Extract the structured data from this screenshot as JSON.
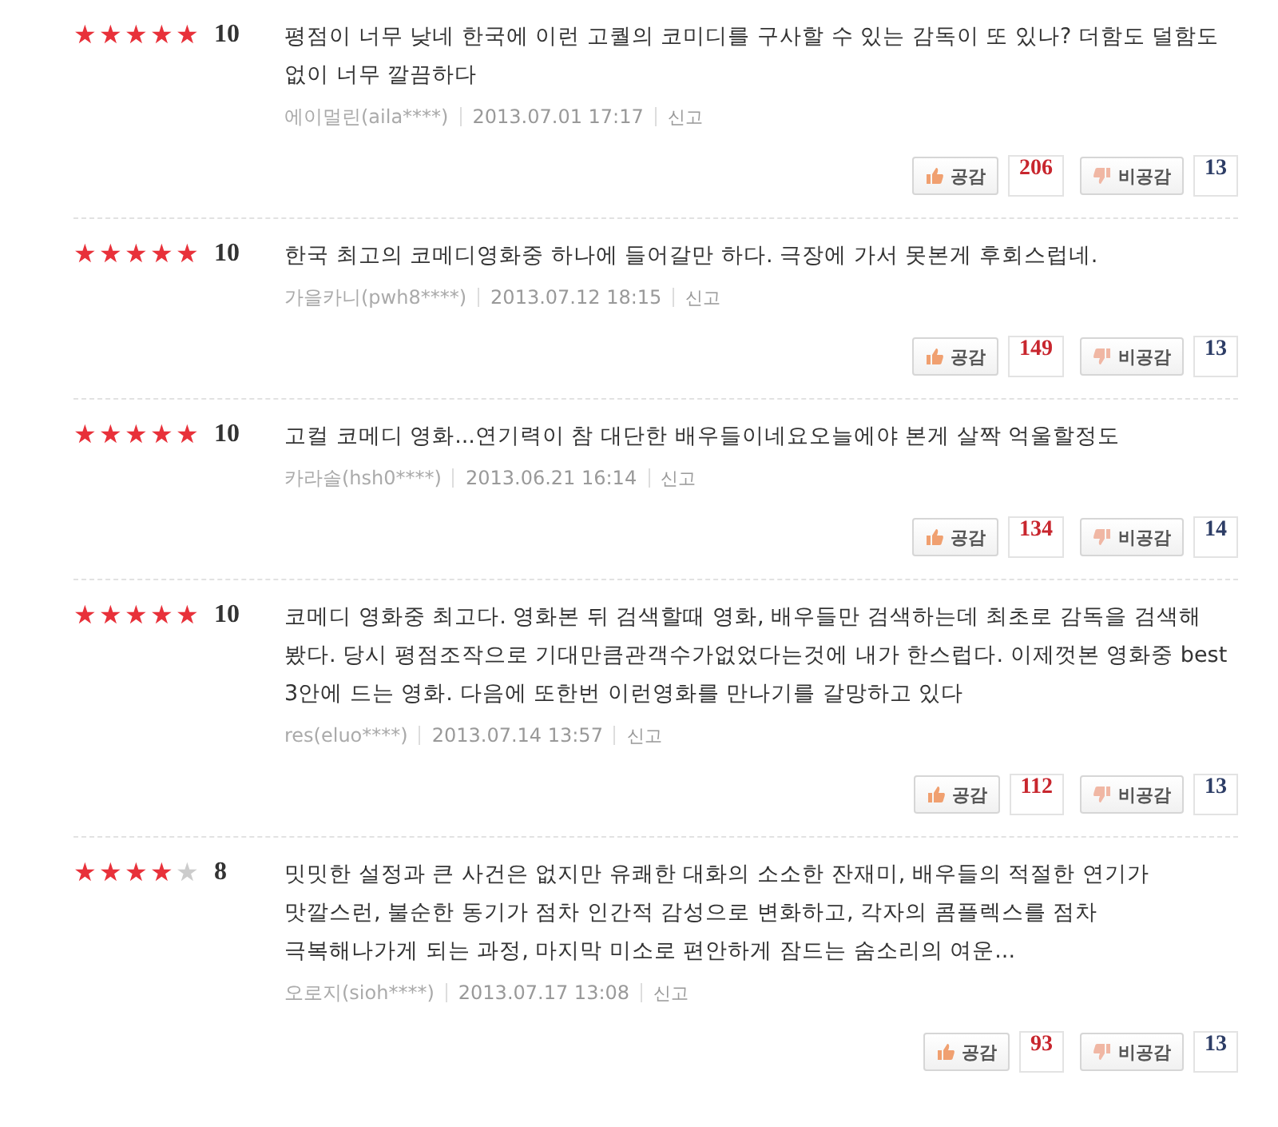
{
  "reviews": [
    {
      "stars": 5,
      "score": "10",
      "text": "평점이 너무 낮네 한국에 이런 고퀄의 코미디를 구사할 수 있는 감독이 또 있나? 더함도 덜함도 없이 너무 깔끔하다",
      "author": "에이멀린(aila****)",
      "date": "2013.07.01 17:17",
      "report": "신고",
      "like_label": "공감",
      "likes": "206",
      "dislike_label": "비공감",
      "dislikes": "13"
    },
    {
      "stars": 5,
      "score": "10",
      "text": "한국 최고의 코메디영화중 하나에 들어갈만 하다. 극장에 가서 못본게 후회스럽네.",
      "author": "가을카니(pwh8****)",
      "date": "2013.07.12 18:15",
      "report": "신고",
      "like_label": "공감",
      "likes": "149",
      "dislike_label": "비공감",
      "dislikes": "13"
    },
    {
      "stars": 5,
      "score": "10",
      "text": "고컬 코메디 영화...연기력이 참 대단한 배우들이네요오늘에야 본게 살짝 억울할정도",
      "author": "카라솔(hsh0****)",
      "date": "2013.06.21 16:14",
      "report": "신고",
      "like_label": "공감",
      "likes": "134",
      "dislike_label": "비공감",
      "dislikes": "14"
    },
    {
      "stars": 5,
      "score": "10",
      "text": "코메디 영화중 최고다. 영화본 뒤 검색할때 영화, 배우들만 검색하는데 최초로 감독을 검색해 봤다. 당시 평점조작으로 기대만큼관객수가없었다는것에 내가 한스럽다. 이제껏본 영화중 best 3안에 드는 영화. 다음에 또한번 이런영화를 만나기를 갈망하고 있다",
      "author": "res(eluo****)",
      "date": "2013.07.14 13:57",
      "report": "신고",
      "like_label": "공감",
      "likes": "112",
      "dislike_label": "비공감",
      "dislikes": "13"
    },
    {
      "stars": 4,
      "score": "8",
      "text": "밋밋한 설정과 큰 사건은 없지만 유쾌한 대화의 소소한 잔재미, 배우들의 적절한 연기가 맛깔스런, 불순한 동기가 점차 인간적 감성으로 변화하고, 각자의 콤플렉스를 점차 극복해나가게 되는 과정, 마지막 미소로 편안하게 잠드는 숨소리의 여운...",
      "author": "오로지(sioh****)",
      "date": "2013.07.17 13:08",
      "report": "신고",
      "like_label": "공감",
      "likes": "93",
      "dislike_label": "비공감",
      "dislikes": "13"
    }
  ]
}
